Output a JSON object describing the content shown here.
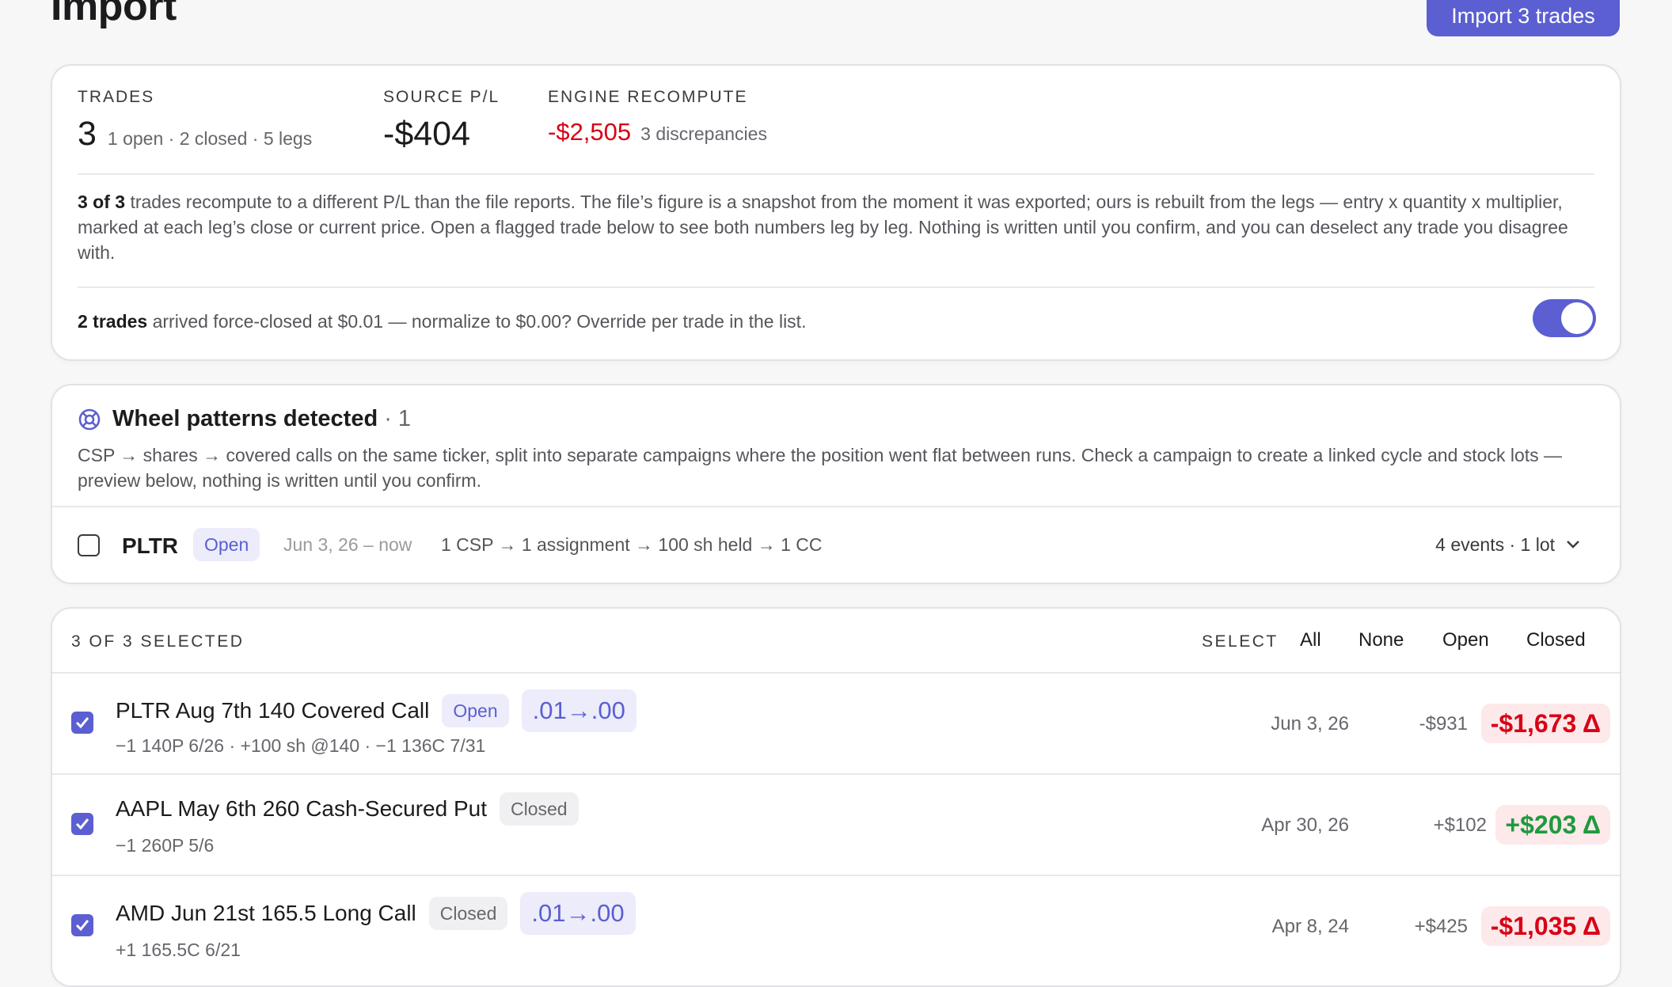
{
  "page": {
    "title": "Import",
    "import_button": "Import 3 trades"
  },
  "summary": {
    "trades_label": "TRADES",
    "trades_value": "3",
    "trades_detail": "1 open · 2 closed · 5 legs",
    "source_label": "SOURCE P/L",
    "source_value": "-$404",
    "engine_label": "ENGINE RECOMPUTE",
    "engine_value": "-$2,505",
    "engine_detail": "3 discrepancies",
    "explain_strong": "3 of 3",
    "explain_text": " trades recompute to a different P/L than the file reports. The file’s figure is a snapshot from the moment it was exported; ours is rebuilt from the legs — entry x quantity x multiplier, marked at each leg’s close or current price. Open a flagged trade below to see both numbers leg by leg. Nothing is written until you confirm, and you can deselect any trade you disagree with.",
    "force_strong": "2 trades",
    "force_text": " arrived force-closed at $0.01 — normalize to $0.00? Override per trade in the list.",
    "normalize_toggle_on": true
  },
  "wheel": {
    "title": "Wheel patterns detected",
    "count": "· 1",
    "description": "CSP → shares → covered calls on the same ticker, split into separate campaigns where the position went flat between runs. Check a campaign to create a linked cycle and stock lots — preview below, nothing is written until you confirm.",
    "campaign": {
      "ticker": "PLTR",
      "status": "Open",
      "dates": "Jun 3, 26 – now",
      "flow": "1 CSP → 1 assignment → 100 sh held → 1 CC",
      "summary": "4 events · 1 lot",
      "checked": false
    }
  },
  "list": {
    "selected_label": "3 OF 3 SELECTED",
    "select_label": "SELECT",
    "select_options": [
      "All",
      "None",
      "Open",
      "Closed"
    ],
    "trades": [
      {
        "name": "PLTR Aug 7th 140 Covered Call",
        "status": "Open",
        "normalize": ".01→.00",
        "legs": "−1 140P 6/26 · +100 sh @140 · −1 136C 7/31",
        "date": "Jun 3, 26",
        "source_pl": "-$931",
        "engine_pl": "-$1,673 Δ",
        "engine_sign": "neg",
        "checked": true
      },
      {
        "name": "AAPL May 6th 260 Cash-Secured Put",
        "status": "Closed",
        "normalize": "",
        "legs": "−1 260P 5/6",
        "date": "Apr 30, 26",
        "source_pl": "+$102",
        "engine_pl": "+$203 Δ",
        "engine_sign": "pos",
        "checked": true
      },
      {
        "name": "AMD Jun 21st 165.5 Long Call",
        "status": "Closed",
        "normalize": ".01→.00",
        "legs": "+1 165.5C 6/21",
        "date": "Apr 8, 24",
        "source_pl": "+$425",
        "engine_pl": "-$1,035 Δ",
        "engine_sign": "neg",
        "checked": true
      }
    ]
  },
  "colors": {
    "accent": "#5b5fd1",
    "negative": "#d70015",
    "positive": "#1f9a3e"
  }
}
